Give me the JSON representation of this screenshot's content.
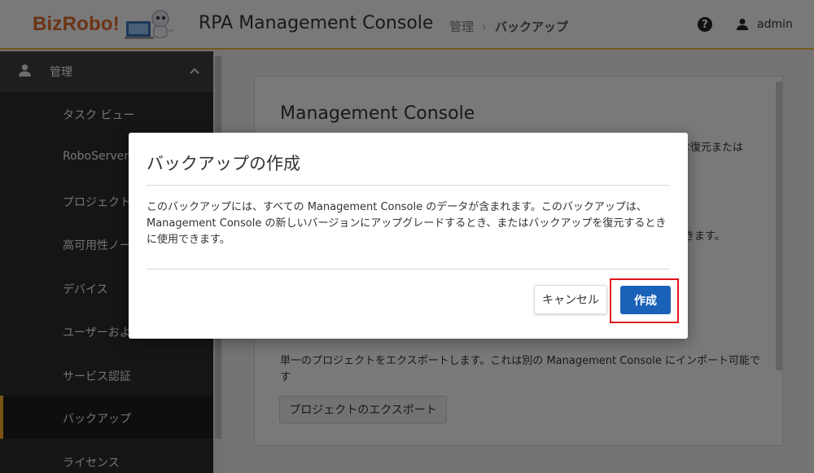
{
  "header": {
    "logo_text": "BizRobo!",
    "app_title": "RPA Management Console",
    "breadcrumb": [
      "管理",
      "バックアップ"
    ],
    "help_icon": "?",
    "user_name": "admin"
  },
  "sidebar": {
    "section_label": "管理",
    "items": [
      {
        "label": "タスク ビュー"
      },
      {
        "label": "RoboServer"
      },
      {
        "label": "プロジェクト"
      },
      {
        "label": "高可用性ノー"
      },
      {
        "label": "デバイス"
      },
      {
        "label": "ユーザーおよ"
      },
      {
        "label": "サービス認証"
      },
      {
        "label": "バックアップ"
      },
      {
        "label": "ライセンス"
      }
    ],
    "active_index": 7
  },
  "main": {
    "card_title": "Management Console",
    "text_fragment1": "な復元または",
    "text_fragment2": "きます。",
    "export_description": "単一のプロジェクトをエクスポートします。これは別の Management Console にインポート可能です",
    "export_button": "プロジェクトのエクスポート"
  },
  "modal": {
    "title": "バックアップの作成",
    "body": "このバックアップには、すべての Management Console のデータが含まれます。このバックアップは、Management Console の新しいバージョンにアップグレードするとき、またはバックアップを復元するときに使用できます。",
    "cancel_label": "キャンセル",
    "create_label": "作成"
  },
  "colors": {
    "accent": "#e2b23a",
    "primary_button": "#1a62b8",
    "highlight": "#e0141e",
    "logo": "#d9672a"
  }
}
